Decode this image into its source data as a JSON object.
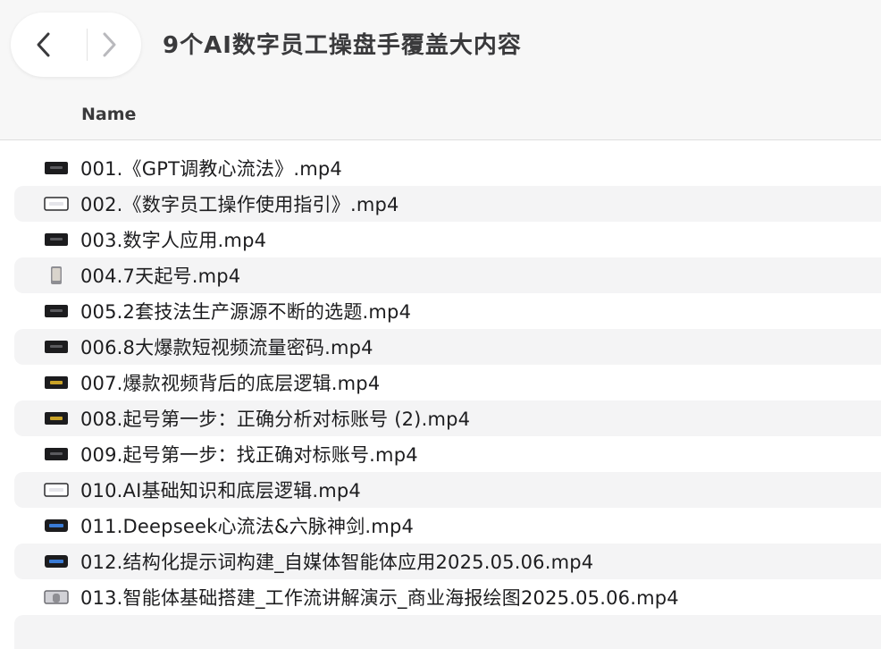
{
  "window": {
    "title": "9个AI数字员工操盘手覆盖大内容"
  },
  "toolbar": {
    "back_icon": "chevron-left-icon",
    "forward_icon": "chevron-right-icon"
  },
  "columns": {
    "name": "Name"
  },
  "files": [
    {
      "name": "001.《GPT调教心流法》.mp4",
      "thumb": "video-dark"
    },
    {
      "name": "002.《数字员工操作使用指引》.mp4",
      "thumb": "video-white"
    },
    {
      "name": "003.数字人应用.mp4",
      "thumb": "video-dark"
    },
    {
      "name": "004.7天起号.mp4",
      "thumb": "video-phone"
    },
    {
      "name": "005.2套技法生产源源不断的选题.mp4",
      "thumb": "video-dark"
    },
    {
      "name": "006.8大爆款短视频流量密码.mp4",
      "thumb": "video-dark"
    },
    {
      "name": "007.爆款视频背后的底层逻辑.mp4",
      "thumb": "video-dark-gold"
    },
    {
      "name": "008.起号第一步：正确分析对标账号 (2).mp4",
      "thumb": "video-dark-gold"
    },
    {
      "name": "009.起号第一步：找正确对标账号.mp4",
      "thumb": "video-dark"
    },
    {
      "name": "010.AI基础知识和底层逻辑.mp4",
      "thumb": "video-white"
    },
    {
      "name": "011.Deepseek心流法&六脉神剑.mp4",
      "thumb": "video-blue"
    },
    {
      "name": "012.结构化提示词构建_自媒体智能体应用2025.05.06.mp4",
      "thumb": "video-blue"
    },
    {
      "name": "013.智能体基础搭建_工作流讲解演示_商业海报绘图2025.05.06.mp4",
      "thumb": "video-person"
    }
  ],
  "colors": {
    "row_alt": "#f4f4f5",
    "toolbar_bg": "#f7f7f7",
    "text": "#1d1d1f"
  }
}
